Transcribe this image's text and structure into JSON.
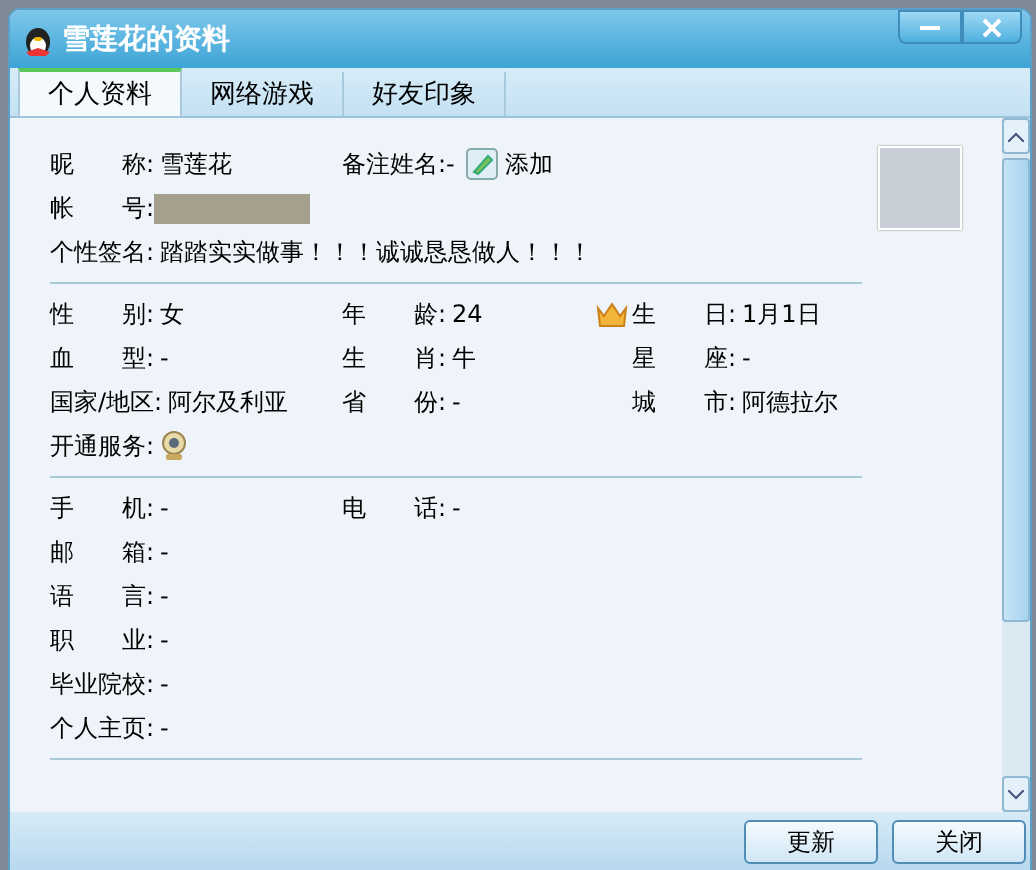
{
  "window": {
    "title": "雪莲花的资料"
  },
  "tabs": [
    {
      "label": "个人资料",
      "selected": true
    },
    {
      "label": "网络游戏",
      "selected": false
    },
    {
      "label": "好友印象",
      "selected": false
    }
  ],
  "sections": [
    {
      "rows": [
        [
          {
            "kind": "text",
            "label": "昵　　称:",
            "value": "雪莲花"
          },
          {
            "kind": "remark",
            "label": "备注姓名:",
            "value": "-",
            "action": "添加"
          }
        ],
        [
          {
            "kind": "redacted",
            "label": "帐　　号:"
          }
        ],
        [
          {
            "kind": "wide",
            "label": "个性签名:",
            "value": "踏踏实实做事！！！诚诚恳恳做人！！！"
          }
        ]
      ]
    },
    {
      "rows": [
        [
          {
            "kind": "text",
            "label": "性　　别:",
            "value": "女"
          },
          {
            "kind": "text",
            "label": "年　　龄:",
            "value": "24"
          },
          {
            "kind": "birthday",
            "label": "生　　日:",
            "value": "1月1日"
          }
        ],
        [
          {
            "kind": "text",
            "label": "血　　型:",
            "value": "-"
          },
          {
            "kind": "text",
            "label": "生　　肖:",
            "value": "牛"
          },
          {
            "kind": "text",
            "label": "星　　座:",
            "value": "-"
          }
        ],
        [
          {
            "kind": "text",
            "label": "国家/地区:",
            "value": "阿尔及利亚"
          },
          {
            "kind": "text",
            "label": "省　　份:",
            "value": "-"
          },
          {
            "kind": "text",
            "label": "城　　市:",
            "value": "阿德拉尔"
          }
        ],
        [
          {
            "kind": "service",
            "label": "开通服务:"
          }
        ]
      ]
    },
    {
      "rows": [
        [
          {
            "kind": "text",
            "label": "手　　机:",
            "value": "-"
          },
          {
            "kind": "text",
            "label": "电　　话:",
            "value": "-"
          }
        ],
        [
          {
            "kind": "text",
            "label": "邮　　箱:",
            "value": "-"
          }
        ],
        [
          {
            "kind": "text",
            "label": "语　　言:",
            "value": "-"
          }
        ],
        [
          {
            "kind": "text",
            "label": "职　　业:",
            "value": "-"
          }
        ],
        [
          {
            "kind": "text",
            "label": "毕业院校:",
            "value": "-"
          }
        ],
        [
          {
            "kind": "text",
            "label": "个人主页:",
            "value": "-"
          }
        ]
      ]
    }
  ],
  "buttons": [
    "更新",
    "关闭"
  ]
}
